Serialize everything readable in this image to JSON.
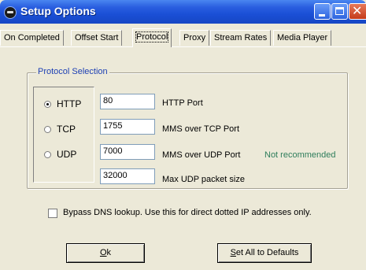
{
  "window": {
    "title": "Setup Options"
  },
  "tabs": [
    {
      "label": "On Completed",
      "selected": false
    },
    {
      "label": "Offset Start",
      "selected": false
    },
    {
      "label": "Protocol",
      "selected": true
    },
    {
      "label": "Proxy",
      "selected": false
    },
    {
      "label": "Stream Rates",
      "selected": false
    },
    {
      "label": "Media Player",
      "selected": false
    }
  ],
  "protocol_selection": {
    "title": "Protocol Selection",
    "options": [
      {
        "label": "HTTP",
        "selected": true
      },
      {
        "label": "TCP",
        "selected": false
      },
      {
        "label": "UDP",
        "selected": false
      }
    ],
    "fields": [
      {
        "value": "80",
        "label": "HTTP Port"
      },
      {
        "value": "1755",
        "label": "MMS over TCP Port"
      },
      {
        "value": "7000",
        "label": "MMS over UDP Port"
      },
      {
        "value": "32000",
        "label": "Max UDP packet size"
      }
    ],
    "udp_note": "Not recommended"
  },
  "bypass_dns": {
    "label": "Bypass DNS lookup. Use this for direct dotted IP addresses only.",
    "checked": false
  },
  "buttons": {
    "ok_mnemonic": "O",
    "ok_rest": "k",
    "defaults_mnemonic": "S",
    "defaults_rest": "et All to Defaults"
  },
  "colors": {
    "titlebar": "#1a4fd6",
    "group_title": "#1c3fb4",
    "note": "#2e7d5b",
    "dialog_bg": "#ece9d8"
  }
}
